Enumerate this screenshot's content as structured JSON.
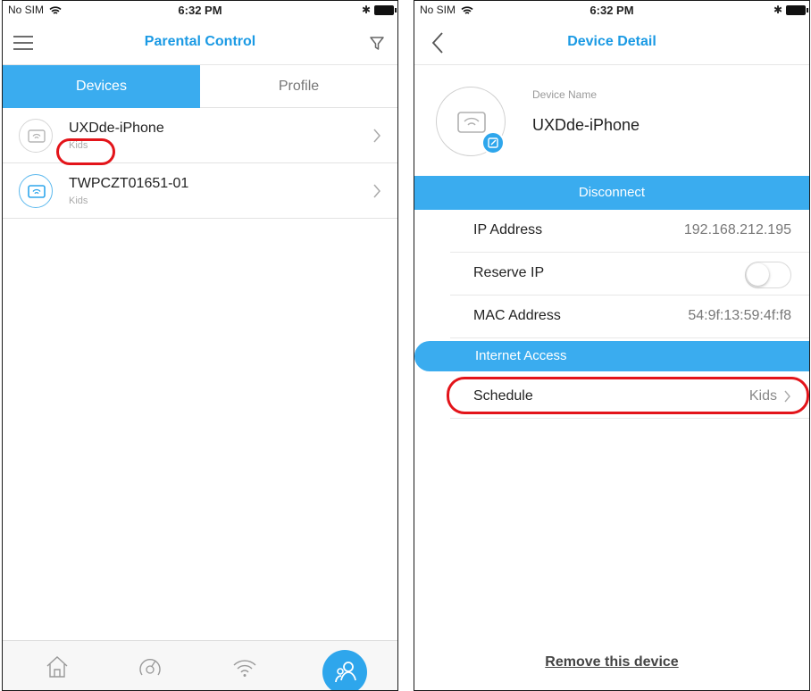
{
  "left_screen": {
    "status_bar": {
      "carrier": "No SIM",
      "time": "6:32 PM"
    },
    "nav": {
      "title": "Parental Control"
    },
    "tabs": [
      {
        "label": "Devices"
      },
      {
        "label": "Profile"
      }
    ],
    "devices": [
      {
        "name": "UXDde-iPhone",
        "profile": "Kids"
      },
      {
        "name": "TWPCZT01651-01",
        "profile": "Kids"
      }
    ],
    "tab_bar": {
      "icons": [
        "home-icon",
        "speed-gauge-icon",
        "wifi-icon",
        "parental-control-icon"
      ]
    }
  },
  "right_screen": {
    "status_bar": {
      "carrier": "No SIM",
      "time": "6:32 PM"
    },
    "nav": {
      "title": "Device Detail"
    },
    "device": {
      "name_label": "Device Name",
      "name": "UXDde-iPhone"
    },
    "disconnect_label": "Disconnect",
    "info": {
      "ip_label": "IP Address",
      "ip_value": "192.168.212.195",
      "reserve_label": "Reserve IP",
      "reserve_on": false,
      "mac_label": "MAC Address",
      "mac_value": "54:9f:13:59:4f:f8"
    },
    "internet_access_label": "Internet Access",
    "schedule": {
      "label": "Schedule",
      "value": "Kids"
    },
    "remove_label": "Remove this device"
  },
  "colors": {
    "accent": "#3aacef",
    "title_blue": "#1b9ae4",
    "annotation_red": "#e3141a"
  }
}
